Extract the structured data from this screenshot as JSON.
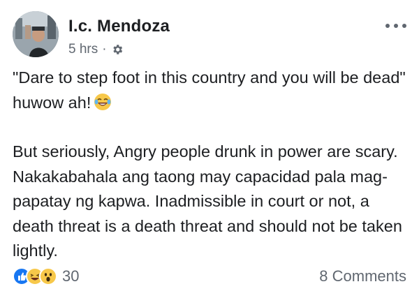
{
  "post": {
    "author": "I.c. Mendoza",
    "timestamp": "5 hrs",
    "separator": "·",
    "privacy_icon": "gear-icon",
    "more_icon": "more-options-icon",
    "paragraph1_text": "\"Dare to step foot in this country and you will be dead\"  huwow ah!",
    "paragraph1_emoji": "laughing-tears-emoji",
    "paragraph2_text": "But seriously, Angry people drunk in power are scary. Nakakabahala ang taong may capacidad pala mag-papatay ng kapwa. Inadmissible in court or not, a death threat is a death threat and should not be taken lightly."
  },
  "footer": {
    "reaction_icons": [
      "like-reaction-icon",
      "haha-reaction-icon",
      "wow-reaction-icon"
    ],
    "reaction_count": "30",
    "comments_label": "8 Comments"
  },
  "colors": {
    "like_blue": "#1877f2",
    "reaction_yellow": "#f7c84a",
    "secondary_text": "#606770"
  }
}
